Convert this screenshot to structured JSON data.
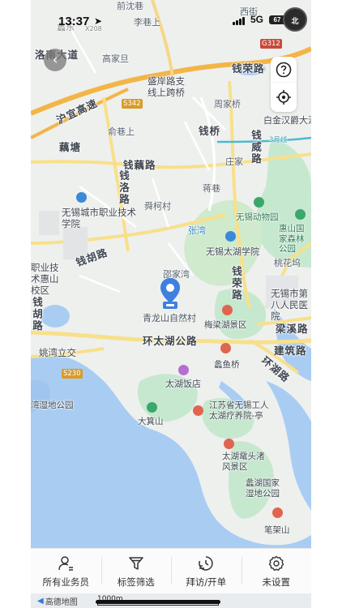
{
  "status_bar": {
    "time": "13:37",
    "network": "5G",
    "battery": "67"
  },
  "compass": {
    "label": "北"
  },
  "controls": {
    "help_icon": "question-circle-icon",
    "locate_icon": "crosshair-icon",
    "back_icon": "chevron-left-icon"
  },
  "marker": {
    "label": "青龙山自然村"
  },
  "map_labels": {
    "l1": "前沈巷",
    "l2": "李巷上",
    "l3": "西街",
    "l4": "蠡东",
    "l5": "洛南大道",
    "l6": "高家旦",
    "l7": "钱荣路",
    "l8": "盛岸路支",
    "l9": "线上跨桥",
    "l10": "周家桥",
    "l11": "沪宜高速",
    "l12": "白金汉爵大酒",
    "l13": "俞巷上",
    "l14": "钱桥",
    "l15": "钱威路",
    "l16": "藕塘",
    "l17": "钱藕路",
    "l18": "庄家",
    "l19": "钱洛路",
    "l20": "蒋巷",
    "l21": "舜柯村",
    "l22": "无锡城市职业技术学院",
    "l23": "无锡动物园",
    "l24": "惠山国家森林公园",
    "l25": "张湾",
    "l26": "无锡太湖学院",
    "l27": "职业技术惠山校区",
    "l28": "钱胡路",
    "l29": "邵家湾",
    "l30": "桃花坞",
    "l31": "钱荣路",
    "l32": "无锡市第八人民医院",
    "l33": "钱胡路",
    "l34": "梅梁湖景区",
    "l35": "梁溪路",
    "l36": "姚湾立交",
    "l37": "环太湖公路",
    "l38": "蠡鱼桥",
    "l39": "建筑路",
    "l40": "环湖路",
    "l41": "太湖饭店",
    "l42": "湾湿地公园",
    "l43": "江苏省无锡工人太湖疗养院-亭",
    "l44": "大箕山",
    "l45": "太湖鼋头渚风景区",
    "l46": "蠡湖国家湿地公园",
    "l47": "笔架山",
    "l48": "3号线",
    "l49": "X208"
  },
  "shields": {
    "s1": "S342",
    "s2": "G312",
    "s3": "S230"
  },
  "toolbar": {
    "items": [
      {
        "label": "所有业务员",
        "icon": "person-icon"
      },
      {
        "label": "标签筛选",
        "icon": "filter-icon"
      },
      {
        "label": "拜访/开单",
        "icon": "clock-icon"
      },
      {
        "label": "未设置",
        "icon": "gear-icon"
      }
    ]
  },
  "attribution": {
    "logo": "高德地图",
    "scale": "1000m"
  }
}
